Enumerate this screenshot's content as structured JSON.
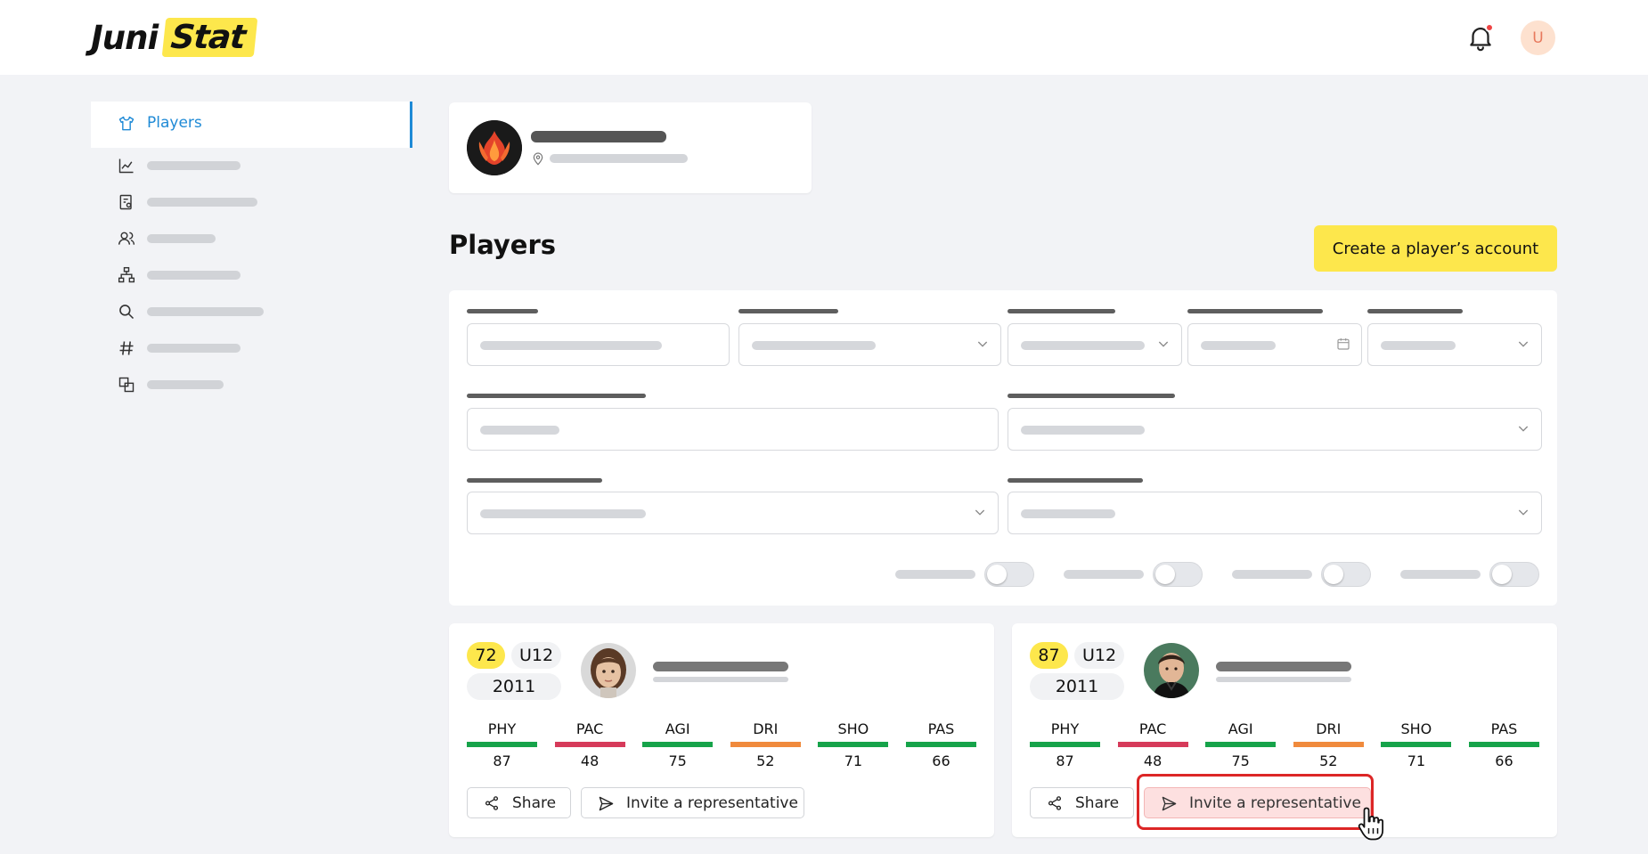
{
  "header": {
    "logo_part1": "Juni",
    "logo_part2": "Stat",
    "avatar_initial": "U"
  },
  "sidebar": {
    "active_label": "Players",
    "items": [
      {
        "icon": "chart-icon"
      },
      {
        "icon": "report-icon"
      },
      {
        "icon": "users-icon"
      },
      {
        "icon": "hierarchy-icon"
      },
      {
        "icon": "search-icon"
      },
      {
        "icon": "hashtag-icon"
      },
      {
        "icon": "copy-icon"
      }
    ]
  },
  "page": {
    "title": "Players",
    "create_button": "Create a player’s account"
  },
  "players": [
    {
      "rating": "72",
      "age_group": "U12",
      "birth_year": "2011",
      "stats": [
        {
          "label": "PHY",
          "value": "87",
          "color": "#16a34a"
        },
        {
          "label": "PAC",
          "value": "48",
          "color": "#d63a5a"
        },
        {
          "label": "AGI",
          "value": "75",
          "color": "#16a34a"
        },
        {
          "label": "DRI",
          "value": "52",
          "color": "#f08a3c"
        },
        {
          "label": "SHO",
          "value": "71",
          "color": "#16a34a"
        },
        {
          "label": "PAS",
          "value": "66",
          "color": "#16a34a"
        }
      ],
      "share_label": "Share",
      "invite_label": "Invite a representative"
    },
    {
      "rating": "87",
      "age_group": "U12",
      "birth_year": "2011",
      "stats": [
        {
          "label": "PHY",
          "value": "87",
          "color": "#16a34a"
        },
        {
          "label": "PAC",
          "value": "48",
          "color": "#d63a5a"
        },
        {
          "label": "AGI",
          "value": "75",
          "color": "#16a34a"
        },
        {
          "label": "DRI",
          "value": "52",
          "color": "#f08a3c"
        },
        {
          "label": "SHO",
          "value": "71",
          "color": "#16a34a"
        },
        {
          "label": "PAS",
          "value": "66",
          "color": "#16a34a"
        }
      ],
      "share_label": "Share",
      "invite_label": "Invite a representative"
    }
  ],
  "colors": {
    "accent_yellow": "#fde74c",
    "active_blue": "#1f8ad6",
    "highlight_red": "#dc2626"
  }
}
